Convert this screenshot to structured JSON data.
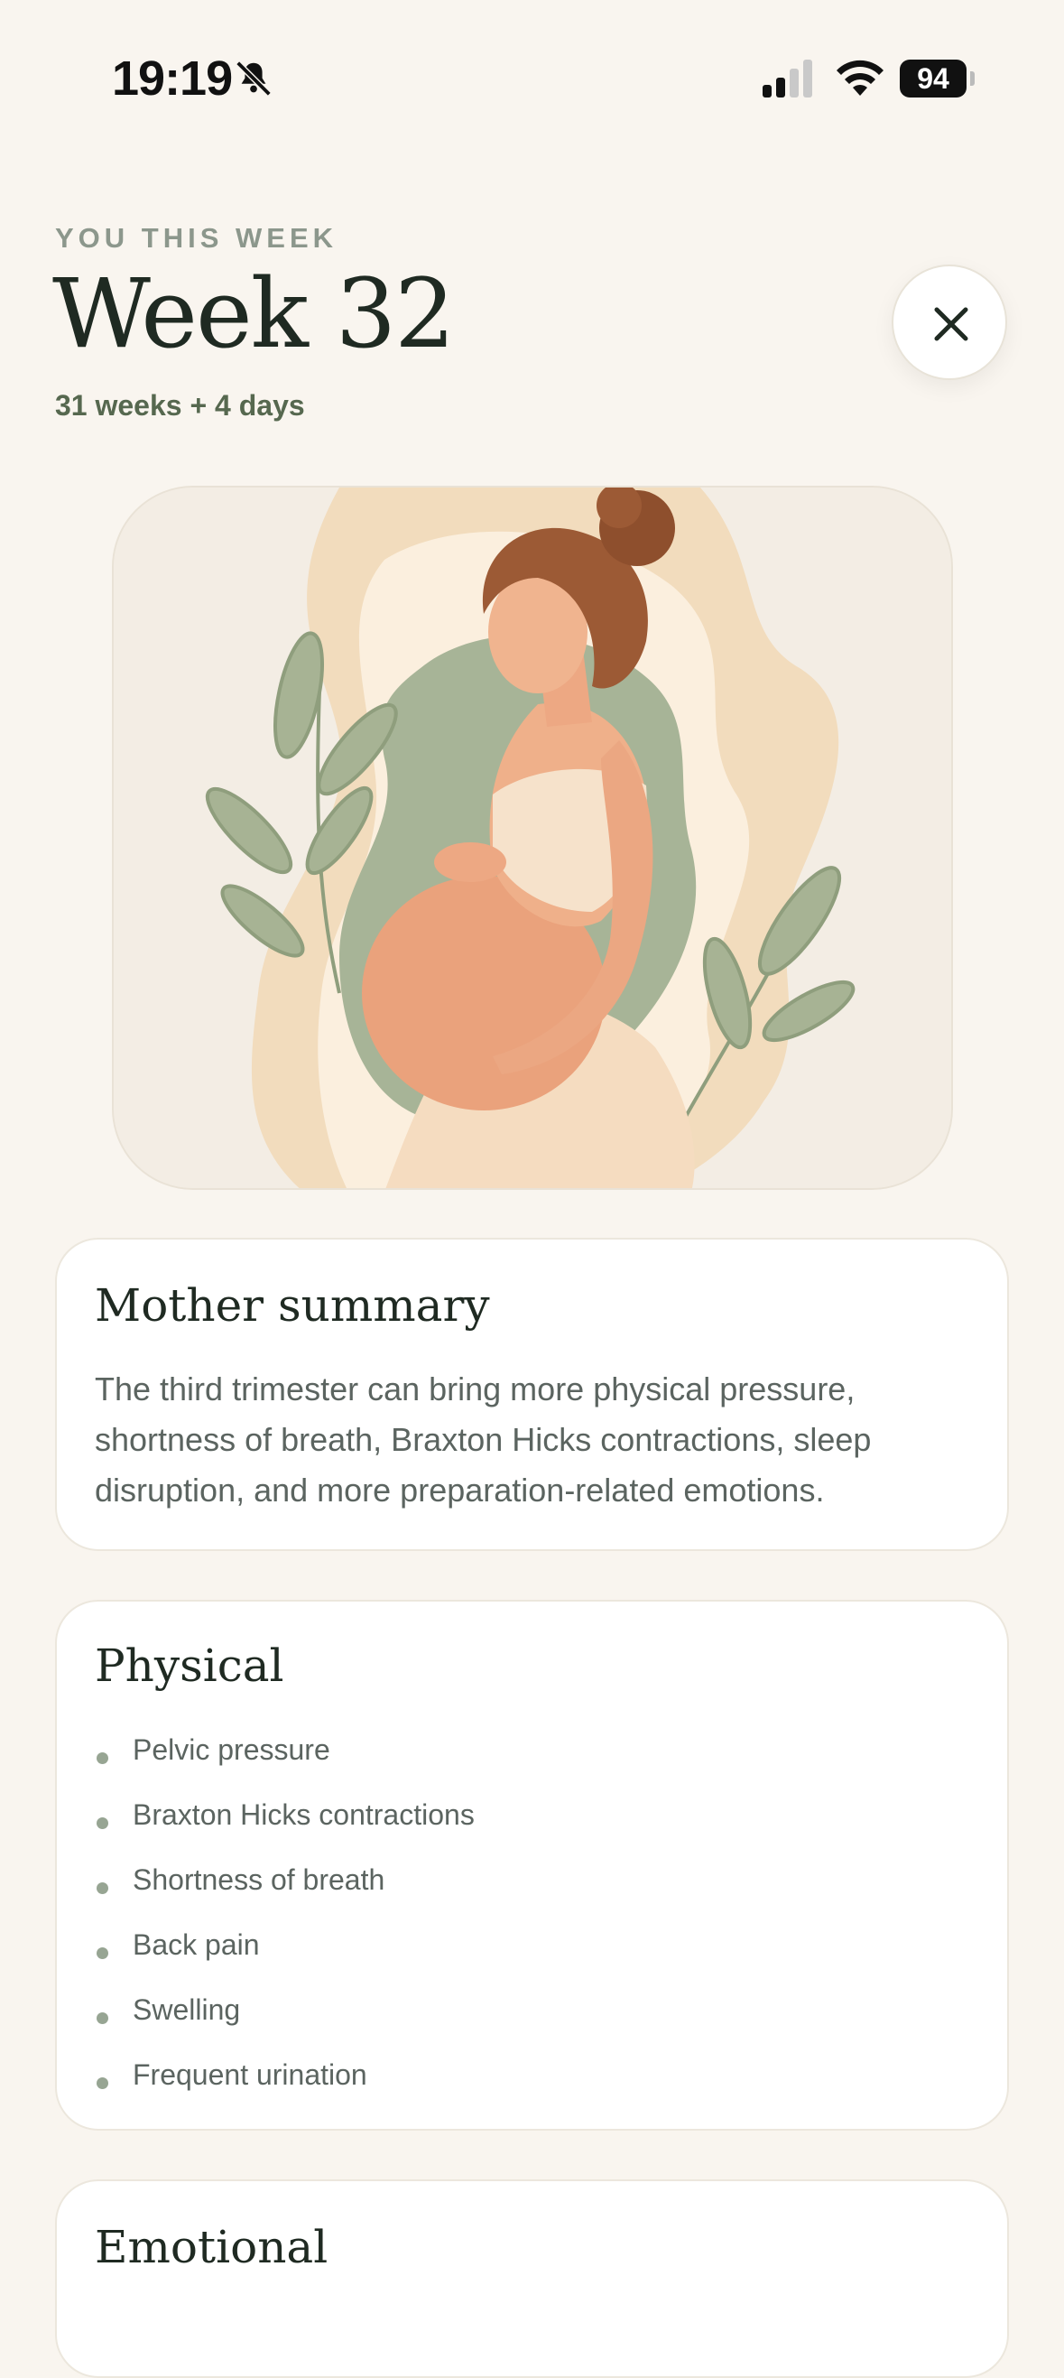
{
  "status_bar": {
    "time": "19:19",
    "battery": "94",
    "icons": [
      "bell-slash-icon",
      "cellular-signal-icon",
      "wifi-icon",
      "battery-icon"
    ]
  },
  "header": {
    "eyebrow": "YOU THIS WEEK",
    "title": "Week 32",
    "subtitle": "31 weeks + 4 days",
    "close_icon": "close-icon"
  },
  "hero": {
    "image_name": "pregnant-woman-illustration"
  },
  "mother_summary": {
    "title": "Mother summary",
    "text": "The third trimester can bring more physical pressure, shortness of breath, Braxton Hicks contractions, sleep disruption, and more preparation-related emotions."
  },
  "physical": {
    "title": "Physical",
    "items": [
      "Pelvic pressure",
      "Braxton Hicks contractions",
      "Shortness of breath",
      "Back pain",
      "Swelling",
      "Frequent urination"
    ]
  },
  "emotional": {
    "title": "Emotional"
  },
  "colors": {
    "background": "#f9f5ef",
    "card": "#ffffff",
    "accent_green": "#56684f",
    "bullet": "#97a593",
    "skin": "#e9a67e",
    "hair": "#9c5a35"
  }
}
